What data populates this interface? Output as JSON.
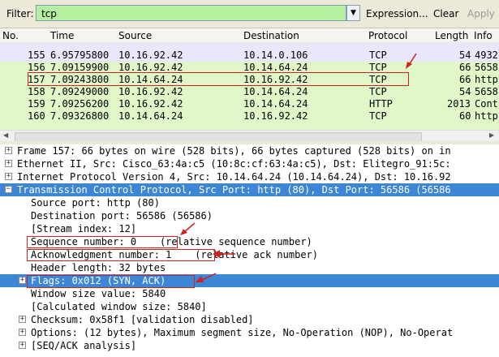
{
  "toolbar": {
    "filter_label": "Filter:",
    "filter_value": "tcp",
    "expression_label": "Expression...",
    "clear_label": "Clear",
    "apply_label": "Apply"
  },
  "columns": [
    "No.",
    "Time",
    "Source",
    "Destination",
    "Protocol",
    "Length",
    "Info"
  ],
  "packets": [
    {
      "no": "155",
      "time": "6.95795800",
      "src": "10.16.92.42",
      "dst": "10.14.0.106",
      "proto": "TCP",
      "len": "54",
      "info": "4932"
    },
    {
      "no": "156",
      "time": "7.09159900",
      "src": "10.16.92.42",
      "dst": "10.14.64.24",
      "proto": "TCP",
      "len": "66",
      "info": "5658"
    },
    {
      "no": "157",
      "time": "7.09243800",
      "src": "10.14.64.24",
      "dst": "10.16.92.42",
      "proto": "TCP",
      "len": "66",
      "info": "http"
    },
    {
      "no": "158",
      "time": "7.09249000",
      "src": "10.16.92.42",
      "dst": "10.14.64.24",
      "proto": "TCP",
      "len": "54",
      "info": "5658"
    },
    {
      "no": "159",
      "time": "7.09256200",
      "src": "10.16.92.42",
      "dst": "10.14.64.24",
      "proto": "HTTP",
      "len": "2013",
      "info": "Cont"
    },
    {
      "no": "160",
      "time": "7.09326800",
      "src": "10.14.64.24",
      "dst": "10.16.92.42",
      "proto": "TCP",
      "len": "60",
      "info": "http"
    }
  ],
  "colors": {
    "row_green": "#e1f7c8",
    "row_lavender": "#e9e7fb",
    "row_white": "#ffffff",
    "selected_blue": "#3d86d6",
    "annotation_red": "#d02020",
    "filter_green": "#b4f0a0"
  },
  "details": {
    "frame": "Frame 157: 66 bytes on wire (528 bits), 66 bytes captured (528 bits) on in",
    "ethernet": "Ethernet II, Src: Cisco_63:4a:c5 (10:8c:cf:63:4a:c5), Dst: Elitegro_91:5c:",
    "ip": "Internet Protocol Version 4, Src: 10.14.64.24 (10.14.64.24), Dst: 10.16.92",
    "tcp": "Transmission Control Protocol, Src Port: http (80), Dst Port: 56586 (56586",
    "src_port": "Source port: http (80)",
    "dst_port": "Destination port: 56586 (56586)",
    "stream_index": "[Stream index: 12]",
    "seq": "Sequence number: 0    (relative sequence number)",
    "ack": "Acknowledgment number: 1    (relative ack number)",
    "header_len": "Header length: 32 bytes",
    "flags": "Flags: 0x012 (SYN, ACK)",
    "window": "Window size value: 5840",
    "calc_window": "[Calculated window size: 5840]",
    "checksum": "Checksum: 0x58f1 [validation disabled]",
    "options": "Options: (12 bytes), Maximum segment size, No-Operation (NOP), No-Operat",
    "seqack": "[SEQ/ACK analysis]"
  }
}
